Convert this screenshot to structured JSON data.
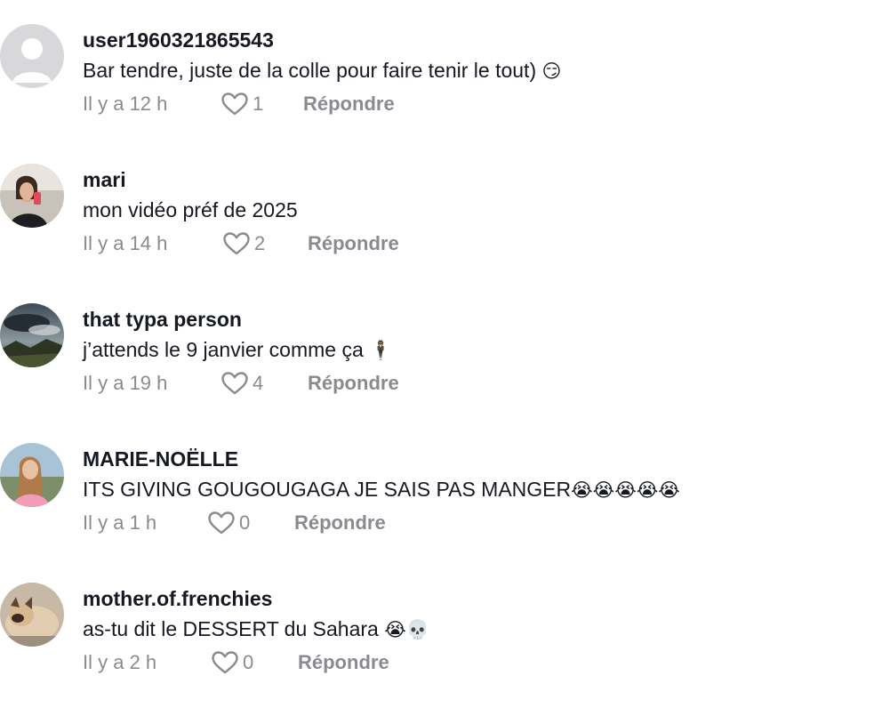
{
  "comments": [
    {
      "username": "user1960321865543",
      "text": "Bar tendre, juste de la colle pour faire tenir le tout)",
      "emoji": "😏",
      "time": "Il y a 12 h",
      "likes": "1",
      "reply_label": "Répondre",
      "avatar": "default-avatar"
    },
    {
      "username": "mari",
      "text": "mon vidéo préf de 2025",
      "emoji": "",
      "time": "Il y a 14 h",
      "likes": "2",
      "reply_label": "Répondre",
      "avatar": "photo-avatar"
    },
    {
      "username": "that typa person",
      "text": "j’attends le 9 janvier comme ça",
      "emoji": "🕴",
      "time": "Il y a 19 h",
      "likes": "4",
      "reply_label": "Répondre",
      "avatar": "landscape-avatar"
    },
    {
      "username": "MARIE-NOËLLE",
      "text": "ITS GIVING GOUGOUGAGA JE SAIS PAS MANGER",
      "emoji": "😭😭😭😭😭",
      "time": "Il y a 1 h",
      "likes": "0",
      "reply_label": "Répondre",
      "avatar": "photo-avatar"
    },
    {
      "username": "mother.of.frenchies",
      "text": "as-tu dit le DESSERT du Sahara",
      "emoji": "😭💀",
      "time": "Il y a 2 h",
      "likes": "0",
      "reply_label": "Répondre",
      "avatar": "dog-avatar"
    }
  ],
  "colors": {
    "text": "#161823",
    "secondary": "#8a8b91",
    "background": "#ffffff"
  }
}
